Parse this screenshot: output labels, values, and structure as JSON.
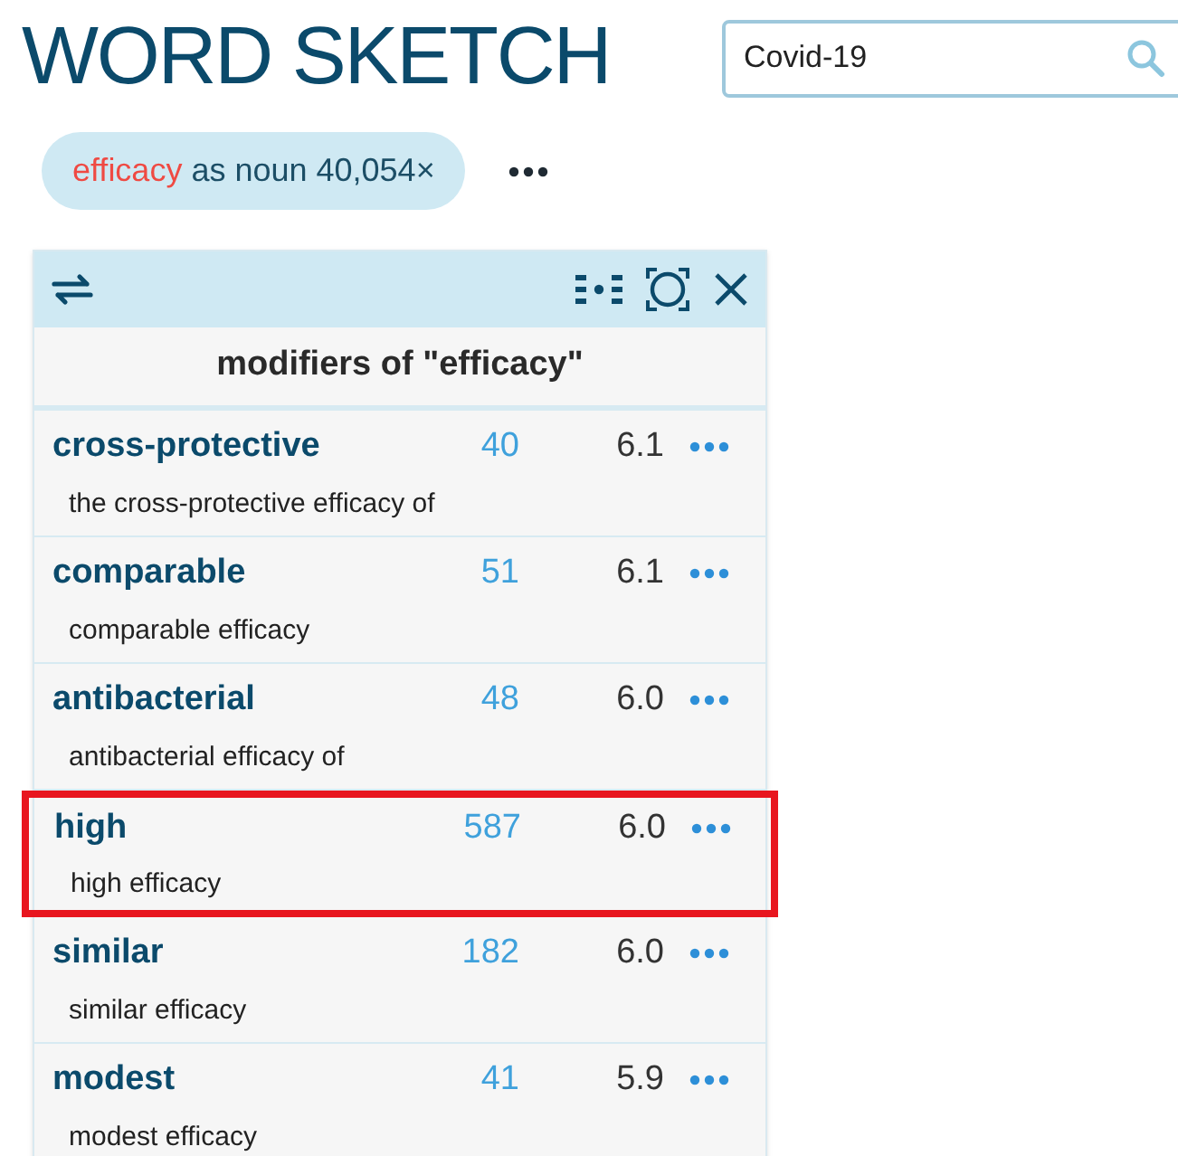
{
  "title": "WORD SKETCH",
  "search": {
    "value": "Covid-19"
  },
  "query": {
    "lemma": "efficacy",
    "details": "as noun 40,054×"
  },
  "panel": {
    "heading": "modifiers of \"efficacy\"",
    "rows": [
      {
        "word": "cross-protective",
        "frequency": "40",
        "score": "6.1",
        "example": "the cross-protective efficacy of",
        "highlighted": false
      },
      {
        "word": "comparable",
        "frequency": "51",
        "score": "6.1",
        "example": "comparable efficacy",
        "highlighted": false
      },
      {
        "word": "antibacterial",
        "frequency": "48",
        "score": "6.0",
        "example": "antibacterial efficacy of",
        "highlighted": false
      },
      {
        "word": "high",
        "frequency": "587",
        "score": "6.0",
        "example": "high efficacy",
        "highlighted": true
      },
      {
        "word": "similar",
        "frequency": "182",
        "score": "6.0",
        "example": "similar efficacy",
        "highlighted": false
      },
      {
        "word": "modest",
        "frequency": "41",
        "score": "5.9",
        "example": "modest efficacy",
        "highlighted": false
      }
    ]
  }
}
